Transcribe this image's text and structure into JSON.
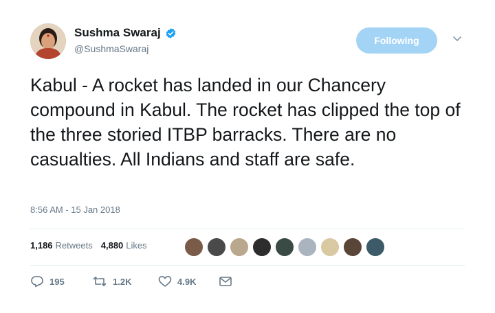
{
  "author": {
    "name": "Sushma Swaraj",
    "handle": "@SushmaSwaraj",
    "verified_icon": "verified-badge-icon",
    "avatar_icon": "avatar"
  },
  "follow_button": {
    "label": "Following"
  },
  "tweet": {
    "text": "Kabul - A rocket has landed in our Chancery compound in Kabul. The rocket has clipped the top of the three storied ITBP barracks. There are no casualties. All Indians and staff are safe.",
    "timestamp": "8:56 AM - 15 Jan 2018"
  },
  "stats": {
    "retweets_count": "1,186",
    "retweets_label": "Retweets",
    "likes_count": "4,880",
    "likes_label": "Likes"
  },
  "actions": {
    "reply_count": "195",
    "retweet_count": "1.2K",
    "like_count": "4.9K"
  },
  "colors": {
    "accent": "#1da1f2",
    "follow_bg": "#a4d4f5",
    "muted": "#657786",
    "divider": "#e6ecf0"
  }
}
